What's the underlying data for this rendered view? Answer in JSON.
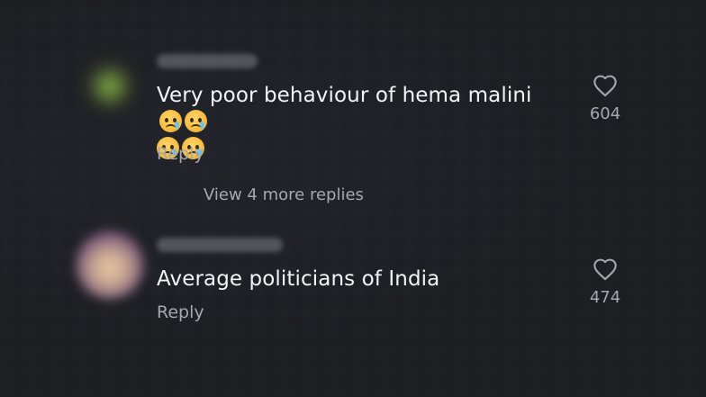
{
  "comments": [
    {
      "text": "Very poor behaviour of hema malini",
      "emoji_icon": "crying-face-emoji",
      "emoji_count": 4,
      "reply_label": "Reply",
      "likes": "604"
    },
    {
      "text": "Average politicians of India",
      "reply_label": "Reply",
      "likes": "474"
    }
  ],
  "view_more_label": "View 4 more replies",
  "colors": {
    "background": "#1d1e22",
    "text": "#f3f3f5",
    "muted": "#a6a8b0"
  }
}
